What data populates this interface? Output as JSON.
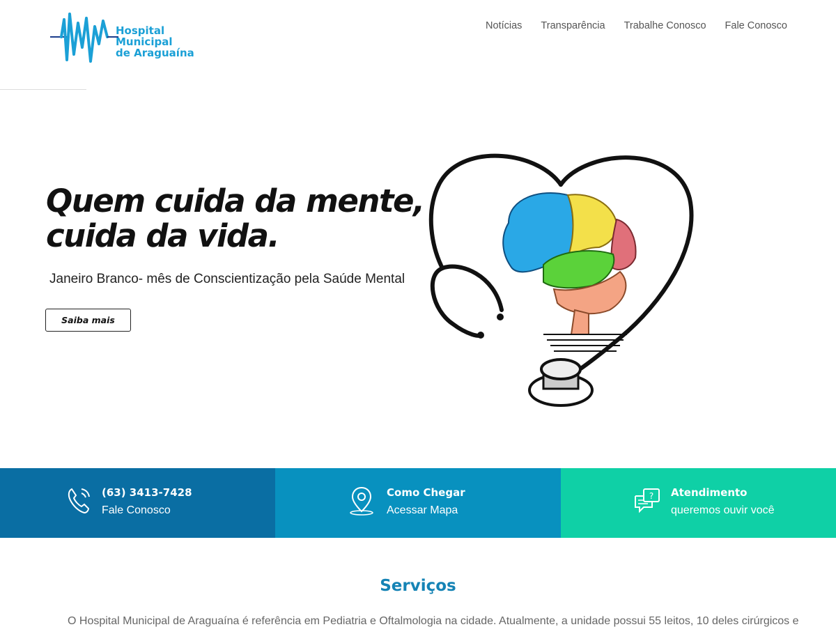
{
  "header": {
    "logo_lines": [
      "Hospital",
      "Municipal",
      "de Araguaína"
    ],
    "nav": [
      {
        "label": "Notícias"
      },
      {
        "label": "Transparência"
      },
      {
        "label": "Trabalhe Conosco"
      },
      {
        "label": "Fale Conosco"
      }
    ]
  },
  "hero": {
    "title_line1": "Quem cuida da mente,",
    "title_line2": "cuida da vida.",
    "subtitle": "Janeiro Branco- mês de Conscientização pela Saúde Mental",
    "button_label": "Saiba mais",
    "illustration_icon": "heart-stethoscope-brain-icon"
  },
  "info_band": [
    {
      "icon": "phone-icon",
      "line1": "(63) 3413-7428",
      "line2": "Fale Conosco",
      "color": "#0a6ea3"
    },
    {
      "icon": "map-pin-icon",
      "line1": "Como Chegar",
      "line2": "Acessar Mapa",
      "color": "#0891bf"
    },
    {
      "icon": "chat-question-icon",
      "line1": "Atendimento",
      "line2": "queremos ouvir você",
      "color": "#0fd0a6"
    }
  ],
  "services": {
    "title": "Serviços",
    "text": "O Hospital Municipal de Araguaína é referência em Pediatria e Oftalmologia na cidade. Atualmente, a unidade possui 55 leitos, 10 deles cirúrgicos e"
  },
  "colors": {
    "accent": "#1583b5",
    "logo_blue": "#1ba0d6"
  }
}
